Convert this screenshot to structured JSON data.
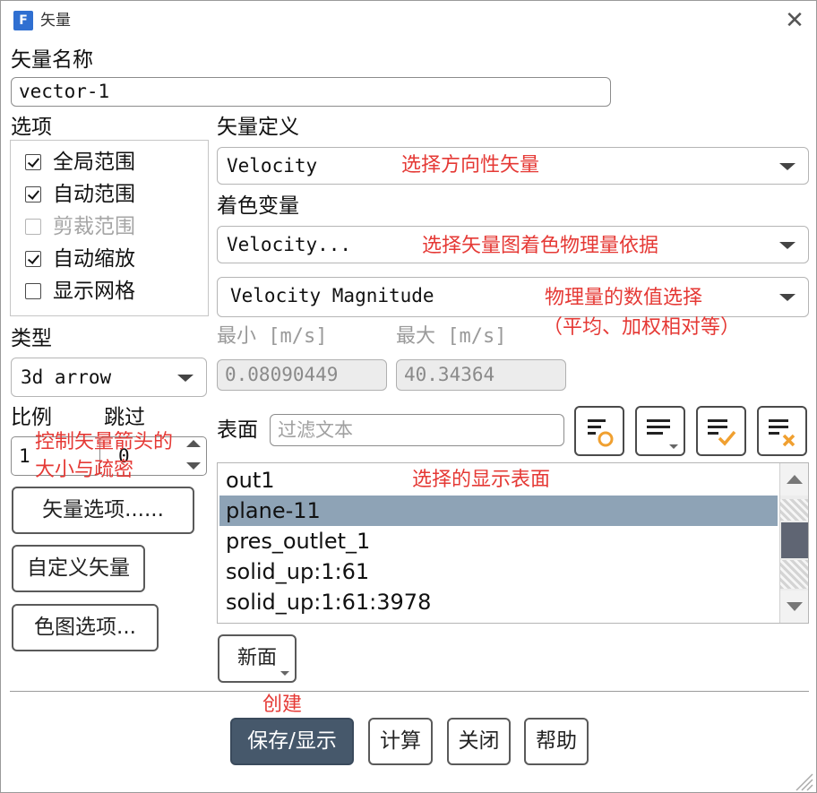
{
  "window": {
    "title": "矢量",
    "app_icon_letter": "F",
    "close_glyph": "✕"
  },
  "vector_name": {
    "label": "矢量名称",
    "value": "vector-1"
  },
  "options": {
    "label": "选项",
    "items": [
      {
        "label": "全局范围",
        "checked": true,
        "enabled": true
      },
      {
        "label": "自动范围",
        "checked": true,
        "enabled": true
      },
      {
        "label": "剪裁范围",
        "checked": false,
        "enabled": false
      },
      {
        "label": "自动缩放",
        "checked": true,
        "enabled": true
      },
      {
        "label": "显示网格",
        "checked": false,
        "enabled": true
      }
    ]
  },
  "vector_definition": {
    "label": "矢量定义",
    "value": "Velocity"
  },
  "color_variable": {
    "label": "着色变量",
    "category_value": "Velocity...",
    "quantity_value": "Velocity Magnitude"
  },
  "range": {
    "min_label": "最小 [m/s]",
    "max_label": "最大 [m/s]",
    "min_value": "0.08090449",
    "max_value": "40.34364"
  },
  "type": {
    "label": "类型",
    "value": "3d arrow"
  },
  "scale": {
    "scale_label": "比例",
    "skip_label": "跳过",
    "scale_value": "1",
    "skip_value": "0"
  },
  "left_buttons": {
    "vector_options": "矢量选项......",
    "custom_vector": "自定义矢量",
    "colormap_options": "色图选项..."
  },
  "surfaces": {
    "label": "表面",
    "filter_placeholder": "过滤文本",
    "items": [
      "out1",
      "plane-11",
      "pres_outlet_1",
      "solid_up:1:61",
      "solid_up:1:61:3978"
    ],
    "selected_index": 1,
    "new_surface_label": "新面"
  },
  "bottom_buttons": {
    "save_display": "保存/显示",
    "compute": "计算",
    "close": "关闭",
    "help": "帮助"
  },
  "annotations": {
    "direction_vector": "选择方向性矢量",
    "color_basis": "选择矢量图着色物理量依据",
    "value_select_1": "物理量的数值选择",
    "value_select_2": "（平均、加权相对等）",
    "arrow_size_1": "控制矢量箭头的",
    "arrow_size_2": "大小与疏密",
    "display_surface": "选择的显示表面",
    "create": "创建"
  },
  "colors": {
    "accent_selected_row": "#8ea3b6",
    "primary_button": "#46586b",
    "annotation": "#e53935",
    "icon_orange": "#f0a030"
  }
}
